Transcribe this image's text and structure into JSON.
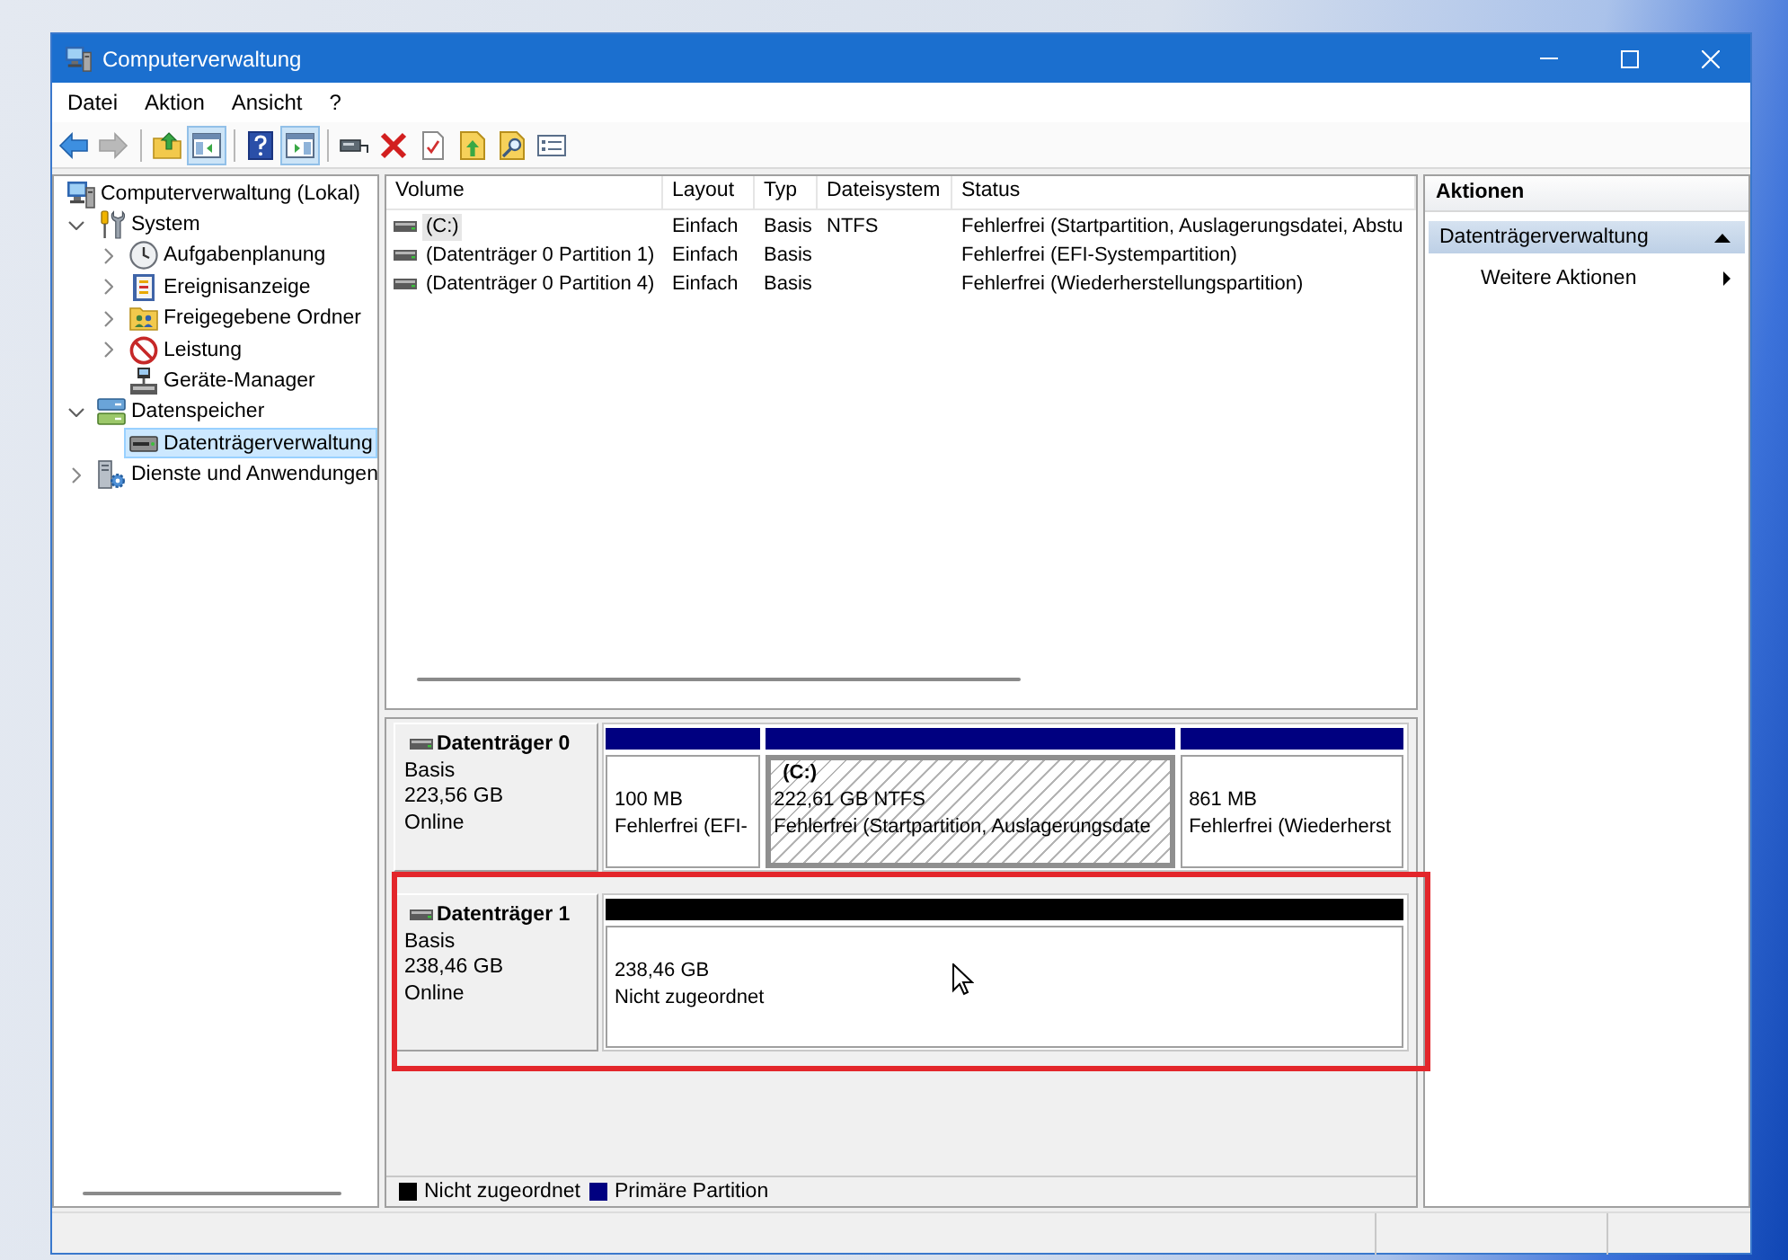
{
  "window": {
    "title": "Computerverwaltung"
  },
  "menu": [
    "Datei",
    "Aktion",
    "Ansicht",
    "?"
  ],
  "toolbar": [
    {
      "kind": "button",
      "pressed": false,
      "disabled": false
    },
    {
      "kind": "button",
      "pressed": false,
      "disabled": true
    },
    {
      "kind": "separator"
    },
    {
      "kind": "button",
      "pressed": false,
      "disabled": false
    },
    {
      "kind": "button",
      "pressed": true,
      "disabled": false
    },
    {
      "kind": "separator"
    },
    {
      "kind": "button",
      "pressed": false,
      "disabled": false
    },
    {
      "kind": "button",
      "pressed": true,
      "disabled": false
    },
    {
      "kind": "separator"
    },
    {
      "kind": "button",
      "pressed": false,
      "disabled": false
    },
    {
      "kind": "button",
      "pressed": false,
      "disabled": false
    },
    {
      "kind": "button",
      "pressed": false,
      "disabled": false
    },
    {
      "kind": "button",
      "pressed": false,
      "disabled": false
    },
    {
      "kind": "button",
      "pressed": false,
      "disabled": false
    },
    {
      "kind": "button",
      "pressed": false,
      "disabled": false
    }
  ],
  "tree": [
    {
      "label": "Computerverwaltung (Lokal)",
      "selected": false,
      "children": [
        {
          "label": "System",
          "expanded": true,
          "selected": false,
          "children": [
            {
              "label": "Aufgabenplanung",
              "expanded": false,
              "selected": false
            },
            {
              "label": "Ereignisanzeige",
              "expanded": false,
              "selected": false
            },
            {
              "label": "Freigegebene Ordner",
              "expanded": false,
              "selected": false
            },
            {
              "label": "Leistung",
              "expanded": false,
              "selected": false
            },
            {
              "label": "Geräte-Manager",
              "selected": false
            }
          ]
        },
        {
          "label": "Datenspeicher",
          "expanded": true,
          "selected": false,
          "children": [
            {
              "label": "Datenträgerverwaltung",
              "selected": true
            }
          ]
        },
        {
          "label": "Dienste und Anwendungen",
          "expanded": false,
          "selected": false
        }
      ]
    }
  ],
  "volume_list": {
    "columns": [
      "Volume",
      "Layout",
      "Typ",
      "Dateisystem",
      "Status"
    ],
    "rows": [
      {
        "volume": "(C:)",
        "layout": "Einfach",
        "type": "Basis",
        "file_system": "NTFS",
        "status": "Fehlerfrei (Startpartition, Auslagerungsdatei, Abstu",
        "selected": true
      },
      {
        "volume": "(Datenträger 0 Partition 1)",
        "layout": "Einfach",
        "type": "Basis",
        "status": "Fehlerfrei (EFI-Systempartition)",
        "selected": false
      },
      {
        "volume": "(Datenträger 0 Partition 4)",
        "layout": "Einfach",
        "type": "Basis",
        "status": "Fehlerfrei (Wiederherstellungspartition)",
        "selected": false
      }
    ]
  },
  "disks": [
    {
      "name": "Datenträger 0",
      "type": "Basis",
      "size": "223,56 GB",
      "status": "Online",
      "highlighted": false,
      "partitions": [
        {
          "kind": "primary",
          "size": "100 MB",
          "status": "Fehlerfrei (EFI-",
          "selected": false
        },
        {
          "kind": "primary",
          "volume": "(C:)",
          "size": "222,61 GB NTFS",
          "status": "Fehlerfrei (Startpartition, Auslagerungsdate",
          "selected": true
        },
        {
          "kind": "primary",
          "size": "861 MB",
          "status": "Fehlerfrei (Wiederherst",
          "selected": false
        }
      ]
    },
    {
      "name": "Datenträger 1",
      "type": "Basis",
      "size": "238,46 GB",
      "status": "Online",
      "highlighted": true,
      "partitions": [
        {
          "kind": "unallocated",
          "size": "238,46 GB",
          "status": "Nicht zugeordnet",
          "selected": false
        }
      ]
    }
  ],
  "legend": [
    {
      "kind": "unallocated",
      "label": "Nicht zugeordnet",
      "color": "#000000"
    },
    {
      "kind": "primary",
      "label": "Primäre Partition",
      "color": "#000080"
    }
  ],
  "actions": {
    "title": "Aktionen",
    "sections": [
      {
        "label": "Datenträgerverwaltung",
        "expanded": true,
        "items": [
          {
            "label": "Weitere Aktionen"
          }
        ]
      }
    ]
  }
}
